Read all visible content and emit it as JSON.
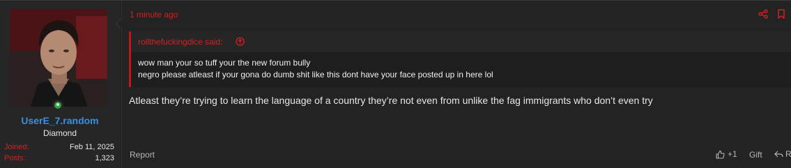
{
  "user": {
    "username": "UserE_7.random",
    "title": "Diamond",
    "joined_label": "Joined:",
    "joined_value": "Feb 11, 2025",
    "posts_label": "Posts:",
    "posts_value": "1,323"
  },
  "post": {
    "time": "1 minute ago",
    "quote": {
      "author": "rollthefuckingdice said:",
      "lines": [
        "wow man your so tuff your the new forum bully",
        "negro please atleast if your gona do dumb shit like this dont have your face posted up in here lol"
      ]
    },
    "message": "Atleast they’re trying to learn the language of a country they’re not even from unlike the fag immigrants who don’t even try"
  },
  "footer": {
    "report": "Report",
    "like_count": "+1",
    "gift": "Gift",
    "reply": "R"
  },
  "colors": {
    "accent_red": "#d42020",
    "username_blue": "#3b8fdc",
    "online_green": "#3a9e46"
  }
}
